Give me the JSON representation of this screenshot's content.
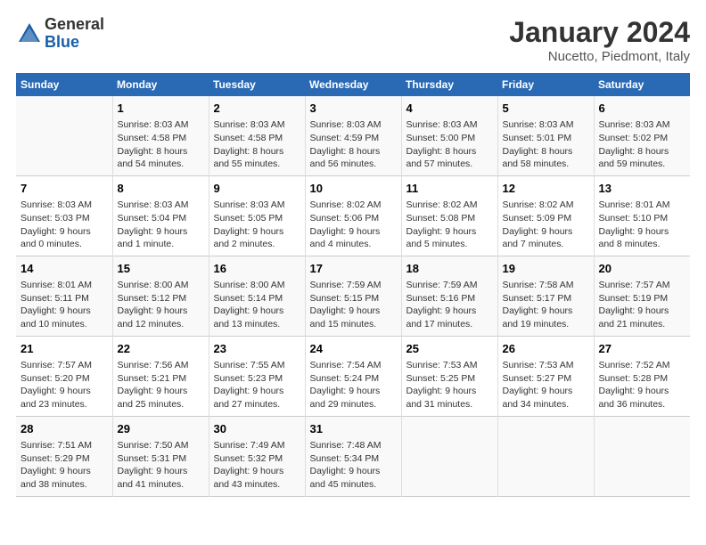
{
  "header": {
    "logo_general": "General",
    "logo_blue": "Blue",
    "title": "January 2024",
    "subtitle": "Nucetto, Piedmont, Italy"
  },
  "weekdays": [
    "Sunday",
    "Monday",
    "Tuesday",
    "Wednesday",
    "Thursday",
    "Friday",
    "Saturday"
  ],
  "weeks": [
    {
      "cells": [
        {
          "day": "",
          "info": ""
        },
        {
          "day": "1",
          "info": "Sunrise: 8:03 AM\nSunset: 4:58 PM\nDaylight: 8 hours\nand 54 minutes."
        },
        {
          "day": "2",
          "info": "Sunrise: 8:03 AM\nSunset: 4:58 PM\nDaylight: 8 hours\nand 55 minutes."
        },
        {
          "day": "3",
          "info": "Sunrise: 8:03 AM\nSunset: 4:59 PM\nDaylight: 8 hours\nand 56 minutes."
        },
        {
          "day": "4",
          "info": "Sunrise: 8:03 AM\nSunset: 5:00 PM\nDaylight: 8 hours\nand 57 minutes."
        },
        {
          "day": "5",
          "info": "Sunrise: 8:03 AM\nSunset: 5:01 PM\nDaylight: 8 hours\nand 58 minutes."
        },
        {
          "day": "6",
          "info": "Sunrise: 8:03 AM\nSunset: 5:02 PM\nDaylight: 8 hours\nand 59 minutes."
        }
      ]
    },
    {
      "cells": [
        {
          "day": "7",
          "info": "Sunrise: 8:03 AM\nSunset: 5:03 PM\nDaylight: 9 hours\nand 0 minutes."
        },
        {
          "day": "8",
          "info": "Sunrise: 8:03 AM\nSunset: 5:04 PM\nDaylight: 9 hours\nand 1 minute."
        },
        {
          "day": "9",
          "info": "Sunrise: 8:03 AM\nSunset: 5:05 PM\nDaylight: 9 hours\nand 2 minutes."
        },
        {
          "day": "10",
          "info": "Sunrise: 8:02 AM\nSunset: 5:06 PM\nDaylight: 9 hours\nand 4 minutes."
        },
        {
          "day": "11",
          "info": "Sunrise: 8:02 AM\nSunset: 5:08 PM\nDaylight: 9 hours\nand 5 minutes."
        },
        {
          "day": "12",
          "info": "Sunrise: 8:02 AM\nSunset: 5:09 PM\nDaylight: 9 hours\nand 7 minutes."
        },
        {
          "day": "13",
          "info": "Sunrise: 8:01 AM\nSunset: 5:10 PM\nDaylight: 9 hours\nand 8 minutes."
        }
      ]
    },
    {
      "cells": [
        {
          "day": "14",
          "info": "Sunrise: 8:01 AM\nSunset: 5:11 PM\nDaylight: 9 hours\nand 10 minutes."
        },
        {
          "day": "15",
          "info": "Sunrise: 8:00 AM\nSunset: 5:12 PM\nDaylight: 9 hours\nand 12 minutes."
        },
        {
          "day": "16",
          "info": "Sunrise: 8:00 AM\nSunset: 5:14 PM\nDaylight: 9 hours\nand 13 minutes."
        },
        {
          "day": "17",
          "info": "Sunrise: 7:59 AM\nSunset: 5:15 PM\nDaylight: 9 hours\nand 15 minutes."
        },
        {
          "day": "18",
          "info": "Sunrise: 7:59 AM\nSunset: 5:16 PM\nDaylight: 9 hours\nand 17 minutes."
        },
        {
          "day": "19",
          "info": "Sunrise: 7:58 AM\nSunset: 5:17 PM\nDaylight: 9 hours\nand 19 minutes."
        },
        {
          "day": "20",
          "info": "Sunrise: 7:57 AM\nSunset: 5:19 PM\nDaylight: 9 hours\nand 21 minutes."
        }
      ]
    },
    {
      "cells": [
        {
          "day": "21",
          "info": "Sunrise: 7:57 AM\nSunset: 5:20 PM\nDaylight: 9 hours\nand 23 minutes."
        },
        {
          "day": "22",
          "info": "Sunrise: 7:56 AM\nSunset: 5:21 PM\nDaylight: 9 hours\nand 25 minutes."
        },
        {
          "day": "23",
          "info": "Sunrise: 7:55 AM\nSunset: 5:23 PM\nDaylight: 9 hours\nand 27 minutes."
        },
        {
          "day": "24",
          "info": "Sunrise: 7:54 AM\nSunset: 5:24 PM\nDaylight: 9 hours\nand 29 minutes."
        },
        {
          "day": "25",
          "info": "Sunrise: 7:53 AM\nSunset: 5:25 PM\nDaylight: 9 hours\nand 31 minutes."
        },
        {
          "day": "26",
          "info": "Sunrise: 7:53 AM\nSunset: 5:27 PM\nDaylight: 9 hours\nand 34 minutes."
        },
        {
          "day": "27",
          "info": "Sunrise: 7:52 AM\nSunset: 5:28 PM\nDaylight: 9 hours\nand 36 minutes."
        }
      ]
    },
    {
      "cells": [
        {
          "day": "28",
          "info": "Sunrise: 7:51 AM\nSunset: 5:29 PM\nDaylight: 9 hours\nand 38 minutes."
        },
        {
          "day": "29",
          "info": "Sunrise: 7:50 AM\nSunset: 5:31 PM\nDaylight: 9 hours\nand 41 minutes."
        },
        {
          "day": "30",
          "info": "Sunrise: 7:49 AM\nSunset: 5:32 PM\nDaylight: 9 hours\nand 43 minutes."
        },
        {
          "day": "31",
          "info": "Sunrise: 7:48 AM\nSunset: 5:34 PM\nDaylight: 9 hours\nand 45 minutes."
        },
        {
          "day": "",
          "info": ""
        },
        {
          "day": "",
          "info": ""
        },
        {
          "day": "",
          "info": ""
        }
      ]
    }
  ]
}
